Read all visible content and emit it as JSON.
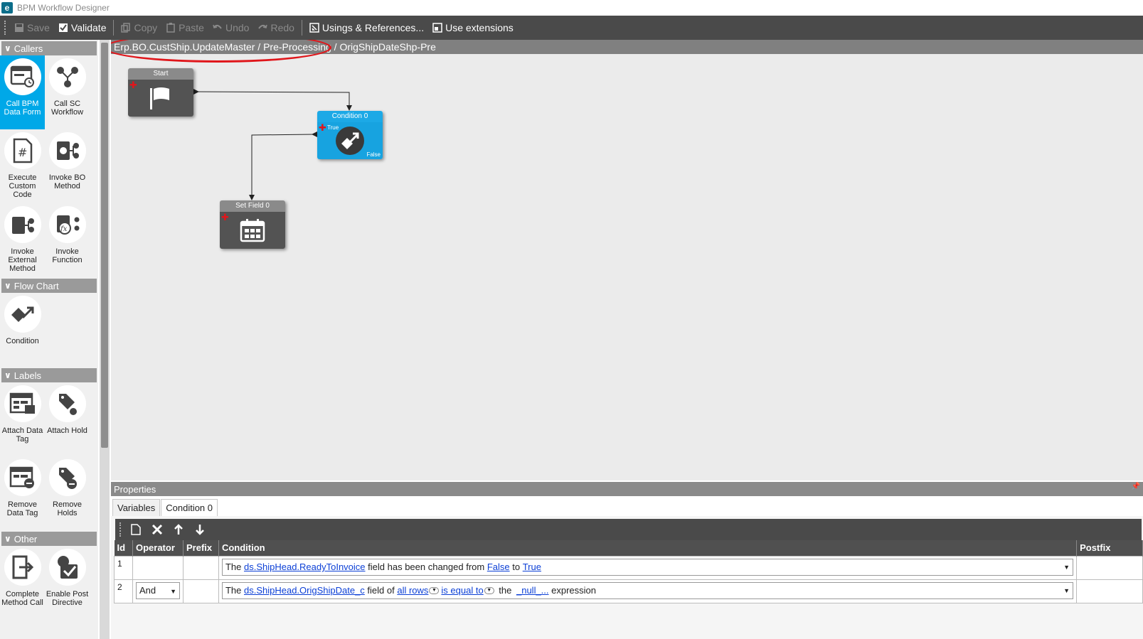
{
  "app": {
    "logo": "e",
    "title": "BPM Workflow Designer"
  },
  "toolbar": {
    "save": "Save",
    "validate": "Validate",
    "copy": "Copy",
    "paste": "Paste",
    "undo": "Undo",
    "redo": "Redo",
    "usings": "Usings & References...",
    "extensions": "Use extensions"
  },
  "sidebar": {
    "categories": [
      {
        "name": "Callers",
        "tools": [
          "Call BPM Data Form",
          "Call SC Workflow",
          "Execute Custom Code",
          "Invoke BO Method",
          "Invoke External Method",
          "Invoke Function"
        ]
      },
      {
        "name": "Flow Chart",
        "tools": [
          "Condition"
        ]
      },
      {
        "name": "Labels",
        "tools": [
          "Attach Data Tag",
          "Attach Hold",
          "Remove Data Tag",
          "Remove Holds"
        ]
      },
      {
        "name": "Other",
        "tools": [
          "Complete Method Call",
          "Enable Post Directive"
        ]
      }
    ]
  },
  "breadcrumb": "Erp.BO.CustShip.UpdateMaster / Pre-Processing / OrigShipDateShp-Pre",
  "nodes": {
    "start": {
      "title": "Start"
    },
    "condition": {
      "title": "Condition 0",
      "true_label": "True",
      "false_label": "False"
    },
    "setfield": {
      "title": "Set Field 0"
    }
  },
  "properties": {
    "header": "Properties",
    "tabs": [
      "Variables",
      "Condition 0"
    ],
    "columns": {
      "id": "Id",
      "operator": "Operator",
      "prefix": "Prefix",
      "condition": "Condition",
      "postfix": "Postfix"
    },
    "rows": [
      {
        "id": "1",
        "operator": "",
        "t1": "The ",
        "l1": "ds.ShipHead.ReadyToInvoice",
        "t2": " field has been changed from ",
        "l2": "False",
        "t3": " to ",
        "l3": "True"
      },
      {
        "id": "2",
        "operator": "And",
        "t1": "The ",
        "l1": "ds.ShipHead.OrigShipDate_c",
        "t2": " field of ",
        "l2": "all rows",
        "l3": "is equal to",
        "t3": " the ",
        "l4": "_null_...",
        "t4": " expression"
      }
    ]
  },
  "colors": {
    "accent": "#00a8e8",
    "highlight": "#e0161b",
    "toolbar": "#4a4a4a"
  }
}
